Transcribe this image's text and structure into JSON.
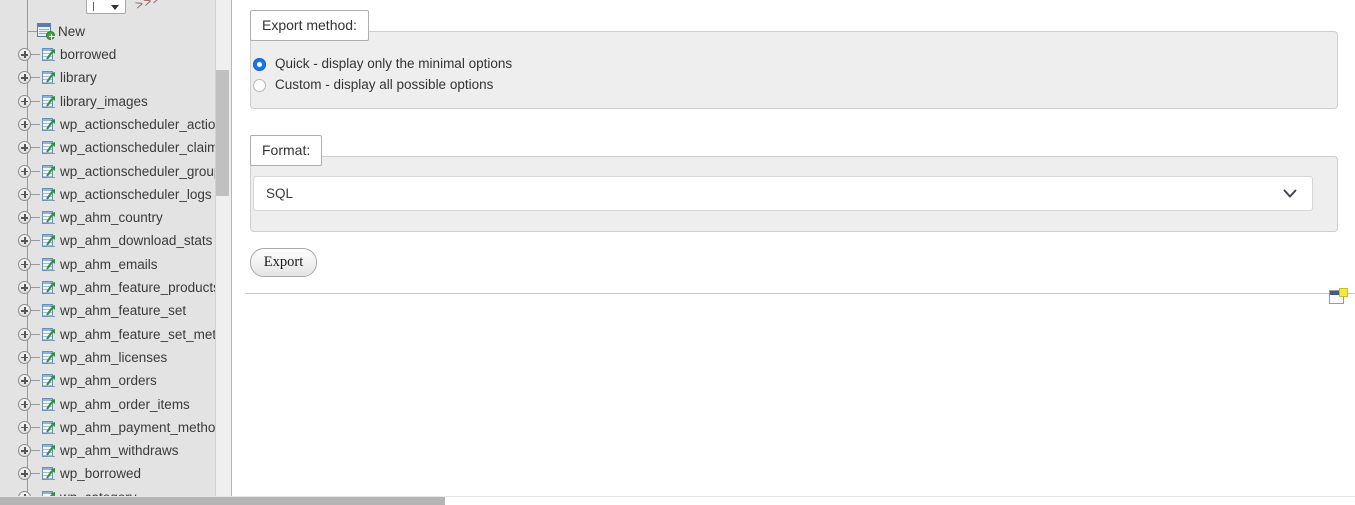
{
  "app": "phpMyAdmin",
  "sidebar": {
    "db_select": {
      "value": "",
      "caret_icon": "caret-down-icon"
    },
    "arrows_icon": "double-chevron-right-icon",
    "new_item": {
      "label": "New",
      "icon": "new-table-icon"
    },
    "expand_icon": "plus-box-icon",
    "table_icon": "table-icon",
    "items": [
      {
        "label": "borrowed"
      },
      {
        "label": "library"
      },
      {
        "label": "library_images"
      },
      {
        "label": "wp_actionscheduler_actions"
      },
      {
        "label": "wp_actionscheduler_claims"
      },
      {
        "label": "wp_actionscheduler_groups"
      },
      {
        "label": "wp_actionscheduler_logs"
      },
      {
        "label": "wp_ahm_country"
      },
      {
        "label": "wp_ahm_download_stats"
      },
      {
        "label": "wp_ahm_emails"
      },
      {
        "label": "wp_ahm_feature_products"
      },
      {
        "label": "wp_ahm_feature_set"
      },
      {
        "label": "wp_ahm_feature_set_meta"
      },
      {
        "label": "wp_ahm_licenses"
      },
      {
        "label": "wp_ahm_orders"
      },
      {
        "label": "wp_ahm_order_items"
      },
      {
        "label": "wp_ahm_payment_methods"
      },
      {
        "label": "wp_ahm_withdraws"
      },
      {
        "label": "wp_borrowed"
      },
      {
        "label": "wp_category"
      }
    ],
    "scrollbar": {
      "orientation": "vertical"
    }
  },
  "main": {
    "export_method": {
      "legend": "Export method:",
      "options": [
        {
          "label": "Quick - display only the minimal options",
          "selected": true
        },
        {
          "label": "Custom - display all possible options",
          "selected": false
        }
      ]
    },
    "format": {
      "legend": "Format:",
      "selected_value": "SQL",
      "chevron_icon": "chevron-down-icon"
    },
    "export_button": {
      "label": "Export"
    },
    "console_icon": "console-window-icon"
  },
  "colors": {
    "sidebar_bg": "#e3e3e3",
    "fieldset_bg": "#eeeeee",
    "fieldset_border": "#cfcfcf",
    "legend_bg": "#ffffff",
    "radio_accent": "#1877e8",
    "text": "#3a3a3a",
    "scroll_thumb": "#b4b4b4"
  }
}
